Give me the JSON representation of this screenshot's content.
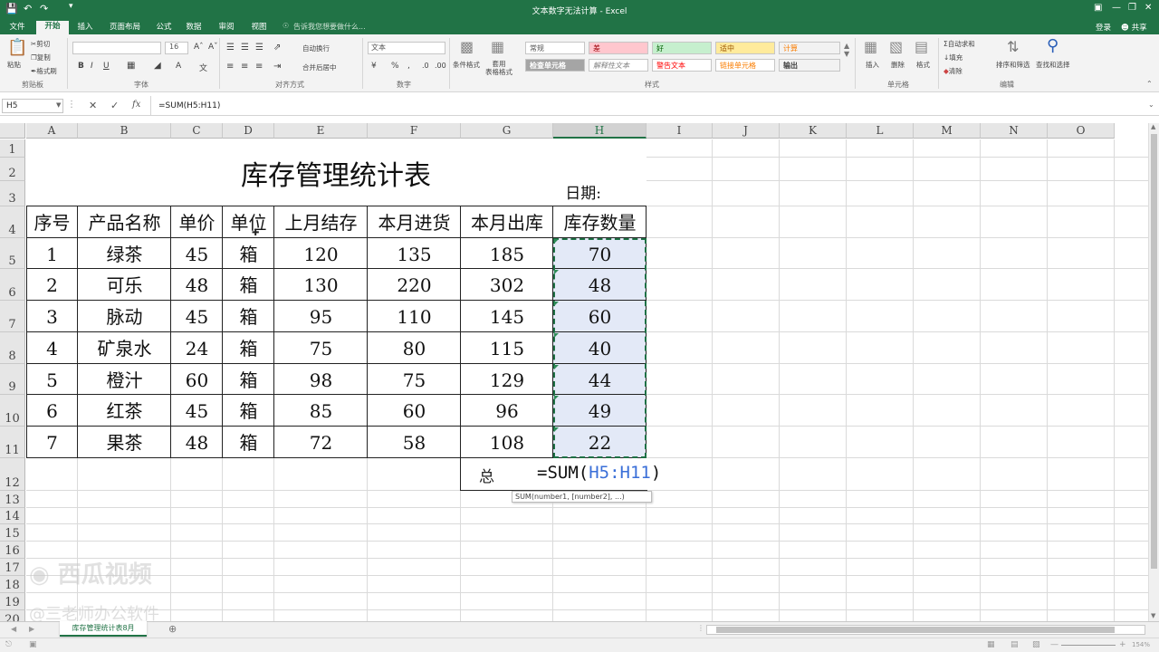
{
  "window": {
    "title": "文本数字无法计算 - Excel",
    "login": "登录",
    "share": "共享"
  },
  "tabs": [
    "文件",
    "开始",
    "插入",
    "页面布局",
    "公式",
    "数据",
    "审阅",
    "视图"
  ],
  "tell_me": "告诉我您想要做什么...",
  "ribbon": {
    "clipboard": {
      "label": "剪贴板",
      "paste": "粘贴",
      "cut": "剪切",
      "copy": "复制",
      "painter": "格式刷"
    },
    "font": {
      "label": "字体",
      "size": "16"
    },
    "alignment": {
      "label": "对齐方式",
      "wrap": "自动换行",
      "merge": "合并后居中"
    },
    "number": {
      "label": "数字",
      "format": "文本"
    },
    "styles": {
      "label": "样式",
      "cond": "条件格式",
      "table": "套用\n表格格式",
      "cells": [
        "常规",
        "差",
        "好",
        "适中",
        "计算",
        "检查单元格",
        "解释性文本",
        "警告文本",
        "链接单元格",
        "输出"
      ]
    },
    "cells": {
      "label": "单元格",
      "insert": "插入",
      "delete": "删除",
      "format": "格式"
    },
    "editing": {
      "label": "编辑",
      "autosum": "自动求和",
      "fill": "填充",
      "clear": "清除",
      "sort": "排序和筛选",
      "find": "查找和选择"
    }
  },
  "formula_bar": {
    "name_box": "H5",
    "formula": "=SUM(H5:H11)"
  },
  "columns": [
    "A",
    "B",
    "C",
    "D",
    "E",
    "F",
    "G",
    "H",
    "I",
    "J",
    "K",
    "L",
    "M",
    "N",
    "O"
  ],
  "rows": [
    "1",
    "2",
    "3",
    "4",
    "5",
    "6",
    "7",
    "8",
    "9",
    "10",
    "11",
    "12",
    "13",
    "14",
    "15",
    "16",
    "17",
    "18",
    "19",
    "20"
  ],
  "sheet": {
    "title": "库存管理统计表",
    "date_label": "日期:",
    "headers": [
      "序号",
      "产品名称",
      "单价",
      "单位",
      "上月结存",
      "本月进货",
      "本月出库",
      "库存数量"
    ],
    "data": [
      [
        "1",
        "绿茶",
        "45",
        "箱",
        "120",
        "135",
        "185",
        "70"
      ],
      [
        "2",
        "可乐",
        "48",
        "箱",
        "130",
        "220",
        "302",
        "48"
      ],
      [
        "3",
        "脉动",
        "45",
        "箱",
        "95",
        "110",
        "145",
        "60"
      ],
      [
        "4",
        "矿泉水",
        "24",
        "箱",
        "75",
        "80",
        "115",
        "40"
      ],
      [
        "5",
        "橙汁",
        "60",
        "箱",
        "98",
        "75",
        "129",
        "44"
      ],
      [
        "6",
        "红茶",
        "45",
        "箱",
        "85",
        "60",
        "96",
        "49"
      ],
      [
        "7",
        "果茶",
        "48",
        "箱",
        "72",
        "58",
        "108",
        "22"
      ]
    ],
    "edit_prefix": "=SUM(",
    "edit_ref": "H5:H11",
    "edit_suffix": ")",
    "total_label_fragment": "总",
    "tooltip": "SUM(number1, [number2], ...)"
  },
  "sheet_tabs": [
    "库存管理统计表8月"
  ],
  "watermark": {
    "brand": "西瓜视频",
    "author": "@三老师办公软件"
  },
  "status": {
    "zoom": "154%"
  },
  "colors": {
    "excel_green": "#217346",
    "ref_blue": "#3a6fd8",
    "selection_fill": "#e3e9f7"
  }
}
